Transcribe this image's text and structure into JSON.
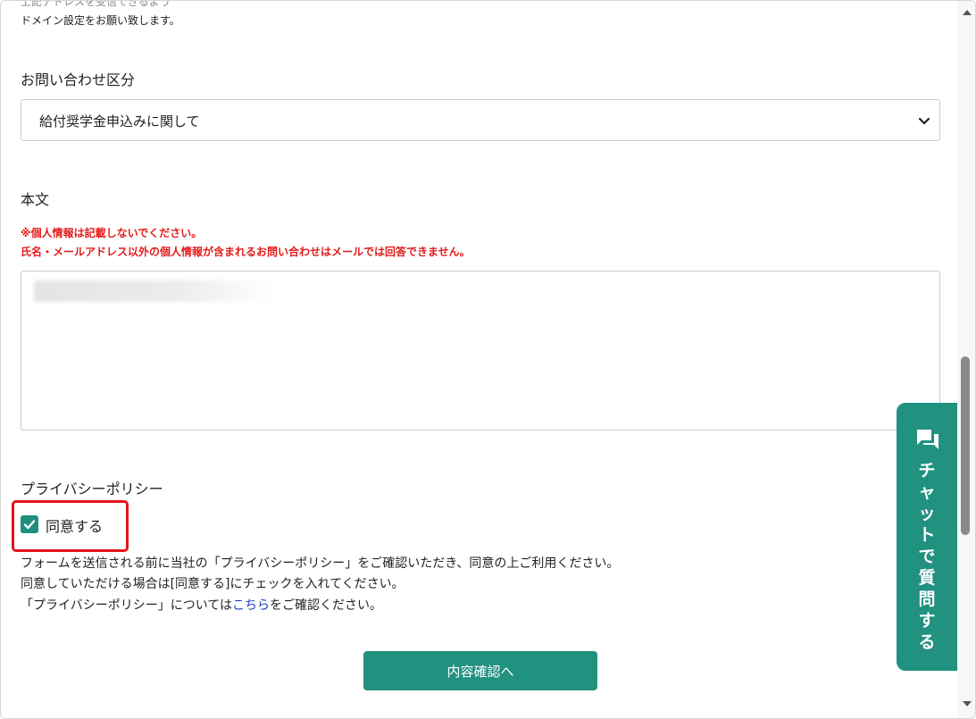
{
  "top": {
    "clipped_line": "上記アドレスを受信できるよう",
    "domain_note": "ドメイン設定をお願い致します。"
  },
  "inquiry": {
    "label": "お問い合わせ区分",
    "selected": "給付奨学金申込みに関して"
  },
  "body_field": {
    "label": "本文",
    "warning_1": "※個人情報は記載しないでください。",
    "warning_2": "氏名・メールアドレス以外の個人情報が含まれるお問い合わせはメールでは回答できません。"
  },
  "privacy": {
    "label": "プライバシーポリシー",
    "agree_label": "同意する",
    "agree_checked": true,
    "info_1": "フォームを送信される前に当社の「プライバシーポリシー」をご確認いただき、同意の上ご利用ください。",
    "info_2": "同意していただける場合は[同意する]にチェックを入れてください。",
    "info_3_prefix": "「プライバシーポリシー」については",
    "info_3_link": "こちら",
    "info_3_suffix": "をご確認ください。"
  },
  "submit": {
    "label": "内容確認へ"
  },
  "chat": {
    "label_chars": [
      "チ",
      "ャ",
      "ッ",
      "ト",
      "で",
      "質",
      "問",
      "す",
      "る"
    ],
    "icon": "chat-bubbles-icon"
  },
  "colors": {
    "accent": "#219180",
    "warning": "#e31b1b",
    "highlight": "#e5141a",
    "link": "#1a3fc4"
  }
}
